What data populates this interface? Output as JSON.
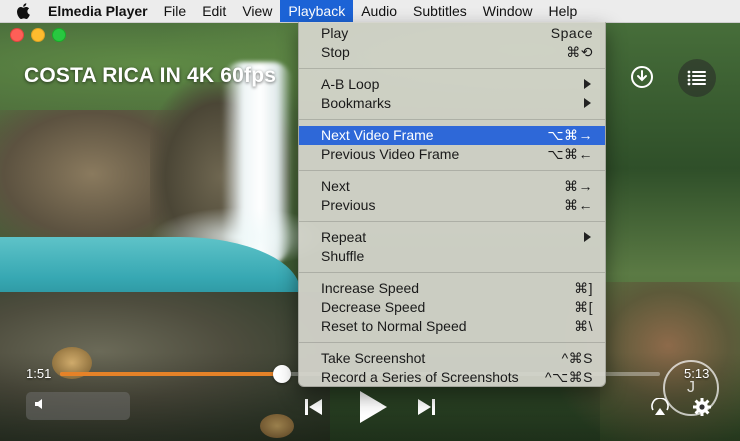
{
  "menubar": {
    "app_name": "Elmedia Player",
    "items": [
      "File",
      "Edit",
      "View",
      "Playback",
      "Audio",
      "Subtitles",
      "Window",
      "Help"
    ],
    "active": "Playback"
  },
  "video": {
    "title": "COSTA RICA IN 4K 60fps",
    "current_time": "1:51",
    "duration": "5:13",
    "progress": 0.37
  },
  "icons": {
    "apple": "apple-logo-icon",
    "download": "download-icon",
    "playlist": "playlist-icon",
    "volume": "speaker-icon",
    "prev": "skip-previous-icon",
    "play": "play-icon",
    "next": "skip-next-icon",
    "airplay": "airplay-icon",
    "settings": "gear-icon"
  },
  "playback_menu": {
    "groups": [
      [
        {
          "label": "Play",
          "shortcut": "Space"
        },
        {
          "label": "Stop",
          "shortcut": "⌘⟲"
        }
      ],
      [
        {
          "label": "A-B Loop",
          "submenu": true
        },
        {
          "label": "Bookmarks",
          "submenu": true
        }
      ],
      [
        {
          "label": "Next Video Frame",
          "shortcut": "⌥⌘→",
          "highlighted": true
        },
        {
          "label": "Previous Video Frame",
          "shortcut": "⌥⌘←"
        }
      ],
      [
        {
          "label": "Next",
          "shortcut": "⌘→"
        },
        {
          "label": "Previous",
          "shortcut": "⌘←"
        }
      ],
      [
        {
          "label": "Repeat",
          "submenu": true
        },
        {
          "label": "Shuffle"
        }
      ],
      [
        {
          "label": "Increase Speed",
          "shortcut": "⌘]"
        },
        {
          "label": "Decrease Speed",
          "shortcut": "⌘["
        },
        {
          "label": "Reset to Normal Speed",
          "shortcut": "⌘\\"
        }
      ],
      [
        {
          "label": "Take Screenshot",
          "shortcut": "^⌘S"
        },
        {
          "label": "Record a Series of Screenshots",
          "shortcut": "^⌥⌘S"
        }
      ]
    ]
  },
  "colors": {
    "menu_highlight": "#2e68d8",
    "progress": "#e58228"
  }
}
